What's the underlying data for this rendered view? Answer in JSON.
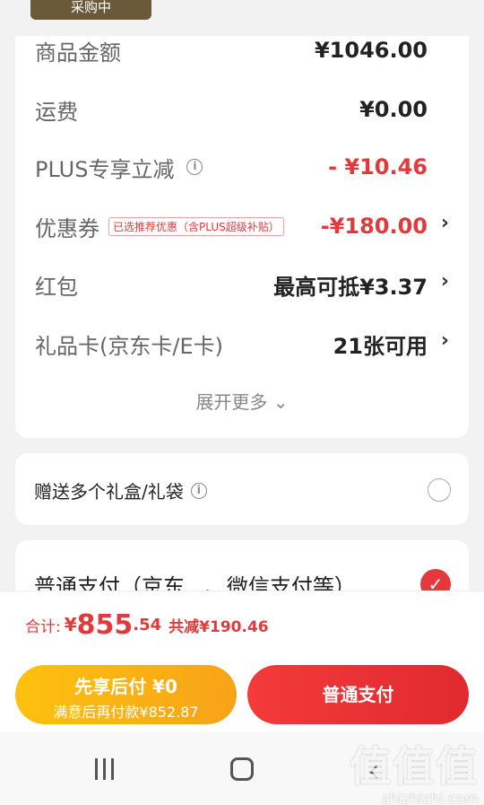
{
  "top_badge": "采购中",
  "summary": {
    "goods_amount_label": "商品金额",
    "goods_amount_value": "¥1046.00",
    "shipping_label": "运费",
    "shipping_value": "¥0.00",
    "plus_label": "PLUS专享立减",
    "plus_value": "- ¥10.46",
    "coupon_label": "优惠券",
    "coupon_tag": "已选推荐优惠（含PLUS超级补贴）",
    "coupon_value": "-¥180.00",
    "redpacket_label": "红包",
    "redpacket_value": "最高可抵¥3.37",
    "giftcard_label": "礼品卡(京东卡/E卡)",
    "giftcard_value": "21张可用",
    "expand_label": "展开更多"
  },
  "gift_box": {
    "label": "赠送多个礼盒/礼袋"
  },
  "payment": {
    "label": "普通支付（京东...、微信支付等）"
  },
  "total": {
    "label": "合计:",
    "currency": "¥",
    "integer": "855",
    "decimal": ".54",
    "savings": "共减¥190.46"
  },
  "actions": {
    "later_title": "先享后付 ¥0",
    "later_subtitle": "满意后再付款¥852.87",
    "normal_label": "普通支付"
  },
  "watermark": {
    "text": "值值值",
    "url": "zhizhizhi.com"
  },
  "colors": {
    "accent": "#e4393c",
    "later": "#fbb516"
  }
}
